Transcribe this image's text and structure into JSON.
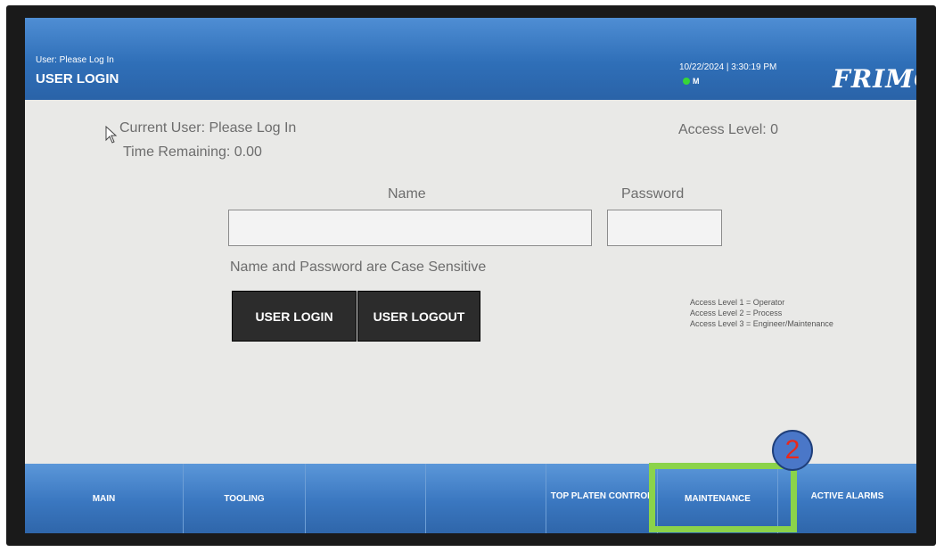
{
  "header": {
    "user_status": "User: Please Log In",
    "title": "USER LOGIN",
    "datetime": "10/22/2024 | 3:30:19 PM",
    "mode": "M",
    "logo": "FRIMO",
    "status_color": "#37d637"
  },
  "login": {
    "current_user": "Current User: Please Log In",
    "time_remaining": "Time Remaining: 0.00",
    "access_level": "Access Level: 0",
    "name_label": "Name",
    "password_label": "Password",
    "name_value": "",
    "password_value": "",
    "case_note": "Name and Password are Case Sensitive",
    "login_button": "USER LOGIN",
    "logout_button": "USER LOGOUT"
  },
  "legend": {
    "lines": [
      "Access Level 1 = Operator",
      "Access Level 2 = Process",
      "Access Level 3 = Engineer/Maintenance"
    ]
  },
  "nav": {
    "items": [
      {
        "label": "MAIN"
      },
      {
        "label": "TOOLING"
      },
      {
        "label": ""
      },
      {
        "label": ""
      },
      {
        "label": "TOP PLATEN CONTROL"
      },
      {
        "label": "MAINTENANCE"
      },
      {
        "label": "ACTIVE ALARMS"
      }
    ]
  },
  "annotation": {
    "step": "2",
    "highlight_color": "#8bd34a",
    "badge_color": "#4a77c8"
  }
}
